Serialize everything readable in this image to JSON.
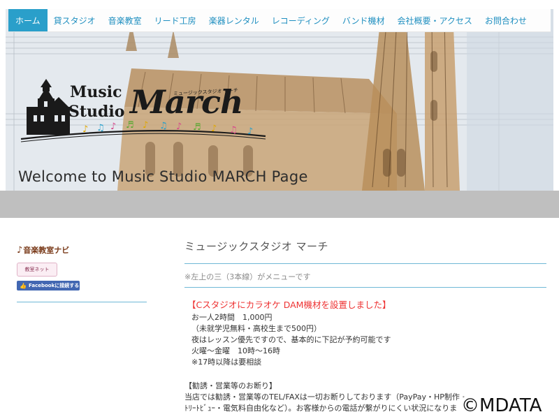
{
  "nav": {
    "items": [
      {
        "label": "ホーム",
        "active": true
      },
      {
        "label": "貸スタジオ",
        "active": false
      },
      {
        "label": "音楽教室",
        "active": false
      },
      {
        "label": "リード工房",
        "active": false
      },
      {
        "label": "楽器レンタル",
        "active": false
      },
      {
        "label": "レコーディング",
        "active": false
      },
      {
        "label": "バンド機材",
        "active": false
      },
      {
        "label": "会社概要・アクセス",
        "active": false
      },
      {
        "label": "お問合わせ",
        "active": false
      }
    ],
    "accent_color": "#2a9fca",
    "link_color": "#1f8fc0"
  },
  "hero": {
    "logo_line1": "Music",
    "logo_line2": "Studio",
    "logo_main": "March",
    "logo_kana": "ミュージックスタジオ マーチ",
    "welcome": "Welcome to Music Studio MARCH Page"
  },
  "sidebar": {
    "banner1": "音楽教室ナビ",
    "banner2": "教室ネット",
    "facebook_button": "Facebookに接続する"
  },
  "main": {
    "title": "ミュージックスタジオ マーチ",
    "menu_note": "※左上の三（3本線）がメニューです",
    "notice": {
      "title": "【Cスタジオにカラオケ DAM機材を設置しました】",
      "lines": [
        "お一人2時間　1,000円",
        "（未就学児無料・高校生まで500円）",
        "夜はレッスン優先ですので、基本的に下記が予約可能です",
        "火曜～金曜　10時～16時",
        "※17時以降は要相談"
      ]
    },
    "solicitation": {
      "title": "【勧誘・営業等のお断り】",
      "lines": [
        "当店では勧誘・営業等のTEL/FAXは一切お断りしております（PayPay・HP制作・",
        "ﾄﾘｰﾄﾋﾞｭｰ・電気料自由化など）。お客様からの電話が繋がりにくい状況になりま"
      ]
    }
  },
  "watermark": "©MDATA"
}
